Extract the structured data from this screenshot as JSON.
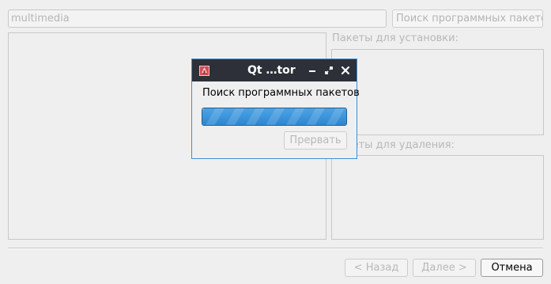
{
  "background": {
    "search": {
      "value": "multimedia"
    },
    "search_button_label": "Поиск программных пакетов",
    "install_label": "Пакеты для установки:",
    "remove_label": "Пакеты для удаления:",
    "buttons": {
      "back": "< Назад",
      "next": "Далее >",
      "cancel": "Отмена"
    }
  },
  "dialog": {
    "title": "Qt …tor",
    "message": "Поиск программных пакетов",
    "progress": 1.0,
    "abort_label": "Прервать",
    "icons": {
      "app": "app-icon",
      "minimize": "minimize-icon",
      "maximize": "maximize-icon",
      "close": "close-icon"
    },
    "colors": {
      "titlebar": "#2d3038",
      "accent": "#3b8fd6",
      "progress": "#2f86cf"
    }
  }
}
